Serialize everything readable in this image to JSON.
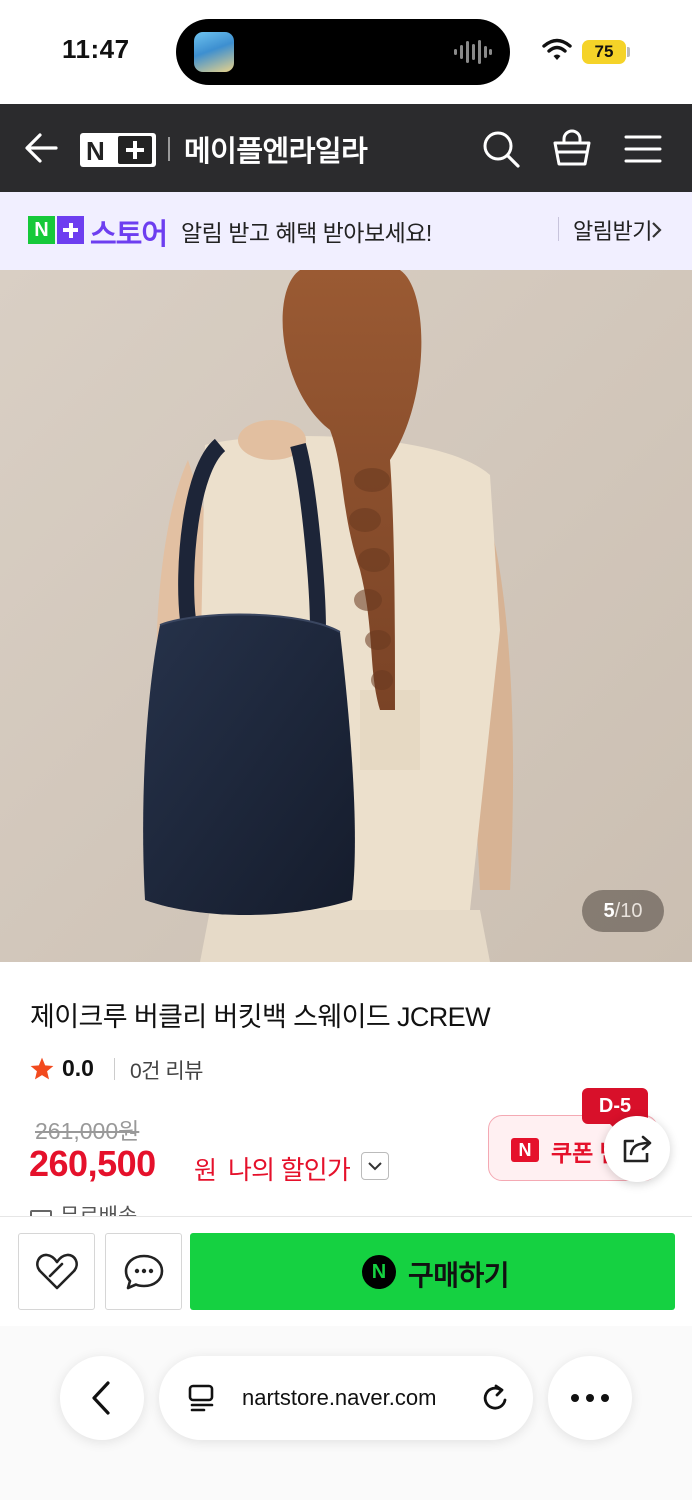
{
  "status_bar": {
    "time": "11:47",
    "battery": "75"
  },
  "header": {
    "title": "메이플엔라일라"
  },
  "store_banner": {
    "brand": "스토어",
    "message": "알림 받고 혜택 받아보세요!",
    "cta": "알림받기"
  },
  "gallery": {
    "current": "5",
    "separator": "/",
    "total": "10"
  },
  "product": {
    "name": "제이크루 버클리 버킷백 스웨이드 JCREW",
    "rating": "0.0",
    "review_count": "0건 리뷰",
    "original_price": "261,000원",
    "sale_price": "260,500",
    "price_unit": "원",
    "my_price_label": "나의 할인가",
    "shipping": "무료배송"
  },
  "coupon": {
    "label": "쿠폰 받",
    "dday": "D-5"
  },
  "actions": {
    "buy_label": "구매하기"
  },
  "browser": {
    "url": "nartstore.naver.com"
  },
  "colors": {
    "header_bg": "#2b2b2d",
    "banner_bg": "#f1efff",
    "brand_purple": "#6d3ef0",
    "naver_green": "#15d141",
    "price_red": "#e5112b"
  }
}
